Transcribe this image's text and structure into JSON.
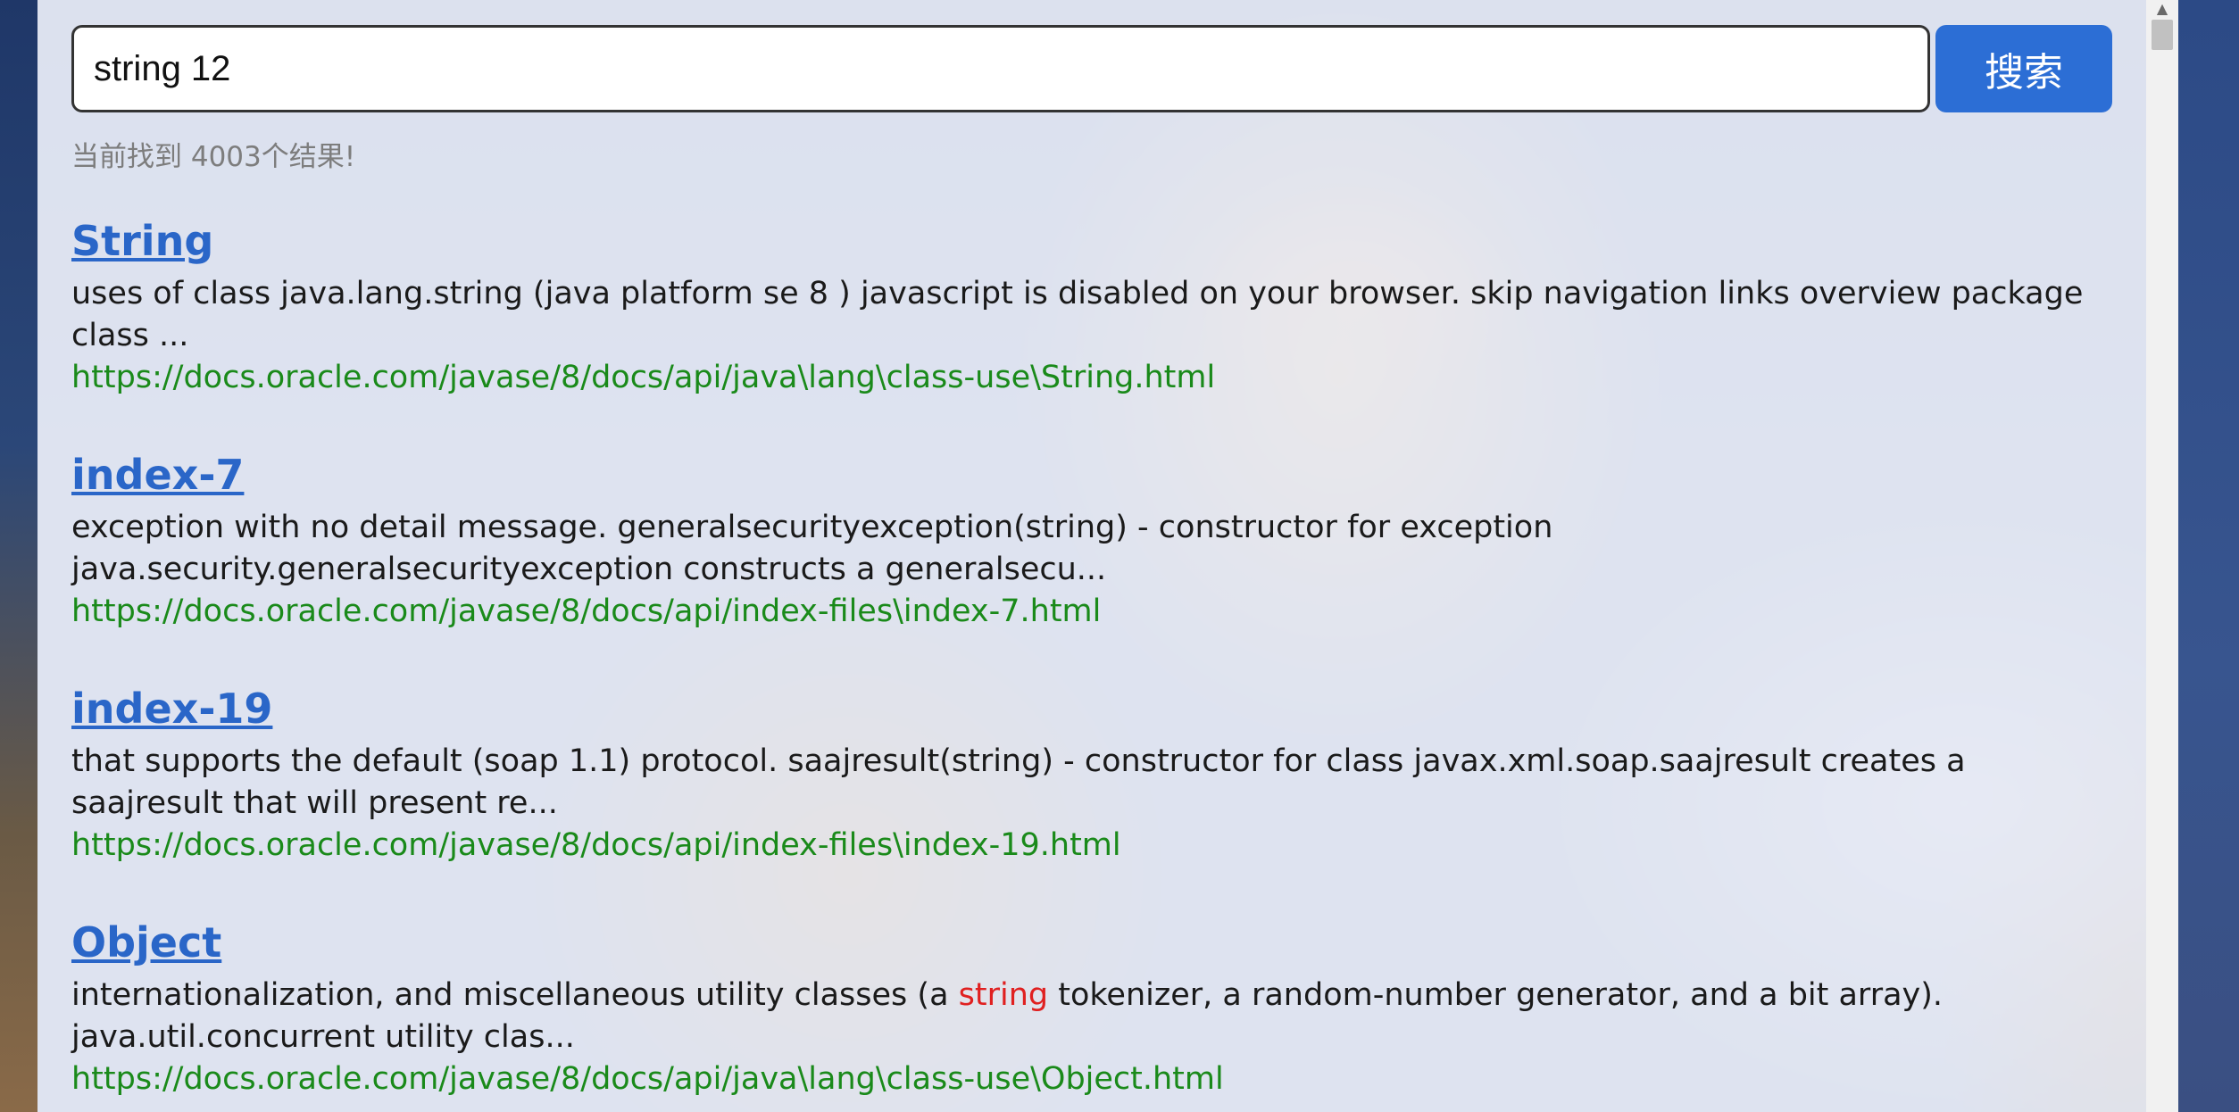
{
  "search": {
    "query": "string 12",
    "button_label": "搜索"
  },
  "result_count_text": "当前找到 4003个结果!",
  "results": [
    {
      "title": "String",
      "desc_before": "uses of class java.lang.string (java platform se 8 ) javascript is disabled on your browser. skip navigation links overview package class ...",
      "highlight": "",
      "desc_after": "",
      "url": "https://docs.oracle.com/javase/8/docs/api/java\\lang\\class-use\\String.html"
    },
    {
      "title": "index-7",
      "desc_before": "exception with no detail message. generalsecurityexception(string) - constructor for exception java.security.generalsecurityexception constructs a generalsecu...",
      "highlight": "",
      "desc_after": "",
      "url": "https://docs.oracle.com/javase/8/docs/api/index-files\\index-7.html"
    },
    {
      "title": "index-19",
      "desc_before": "that supports the default (soap 1.1) protocol. saajresult(string) - constructor for class javax.xml.soap.saajresult creates a saajresult that will present re...",
      "highlight": "",
      "desc_after": "",
      "url": "https://docs.oracle.com/javase/8/docs/api/index-files\\index-19.html"
    },
    {
      "title": "Object",
      "desc_before": "internationalization, and miscellaneous utility classes (a ",
      "highlight": "string",
      "desc_after": " tokenizer, a random-number generator, and a bit array). java.util.concurrent utility clas...",
      "url": "https://docs.oracle.com/javase/8/docs/api/java\\lang\\class-use\\Object.html"
    }
  ],
  "colors": {
    "accent": "#2c6ed5",
    "title_link": "#2a66c8",
    "url": "#1a8a1a",
    "highlight": "#e02020"
  }
}
